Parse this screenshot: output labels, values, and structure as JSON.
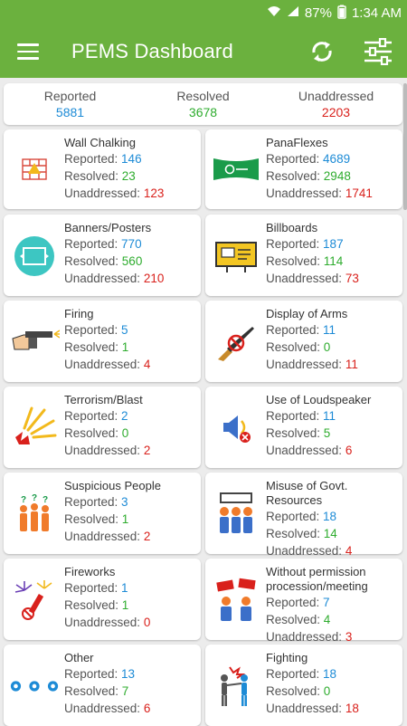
{
  "status_bar": {
    "battery": "87%",
    "time": "1:34 AM"
  },
  "app_bar": {
    "title": "PEMS Dashboard"
  },
  "summary": {
    "reported_label": "Reported",
    "reported_value": "5881",
    "resolved_label": "Resolved",
    "resolved_value": "3678",
    "unaddressed_label": "Unaddressed",
    "unaddressed_value": "2203"
  },
  "labels": {
    "reported": "Reported: ",
    "resolved": "Resolved: ",
    "unaddressed": "Unaddressed: "
  },
  "categories": [
    {
      "title": "Wall Chalking",
      "reported": "146",
      "resolved": "23",
      "unaddressed": "123",
      "icon": "wall-icon"
    },
    {
      "title": "PanaFlexes",
      "reported": "4689",
      "resolved": "2948",
      "unaddressed": "1741",
      "icon": "banner-flag-icon"
    },
    {
      "title": "Banners/Posters",
      "reported": "770",
      "resolved": "560",
      "unaddressed": "210",
      "icon": "poster-icon"
    },
    {
      "title": "Billboards",
      "reported": "187",
      "resolved": "114",
      "unaddressed": "73",
      "icon": "billboard-icon"
    },
    {
      "title": "Firing",
      "reported": "5",
      "resolved": "1",
      "unaddressed": "4",
      "icon": "gun-icon"
    },
    {
      "title": "Display of Arms",
      "reported": "11",
      "resolved": "0",
      "unaddressed": "11",
      "icon": "rifle-icon"
    },
    {
      "title": "Terrorism/Blast",
      "reported": "2",
      "resolved": "0",
      "unaddressed": "2",
      "icon": "blast-icon"
    },
    {
      "title": "Use of Loudspeaker",
      "reported": "11",
      "resolved": "5",
      "unaddressed": "6",
      "icon": "loudspeaker-icon"
    },
    {
      "title": "Suspicious People",
      "reported": "3",
      "resolved": "1",
      "unaddressed": "2",
      "icon": "people-icon"
    },
    {
      "title": "Misuse of Govt. Resources",
      "reported": "18",
      "resolved": "14",
      "unaddressed": "4",
      "icon": "govt-resources-icon"
    },
    {
      "title": "Fireworks",
      "reported": "1",
      "resolved": "1",
      "unaddressed": "0",
      "icon": "fireworks-icon"
    },
    {
      "title": "Without permission procession/meeting",
      "reported": "7",
      "resolved": "4",
      "unaddressed": "3",
      "icon": "procession-icon"
    },
    {
      "title": "Other",
      "reported": "13",
      "resolved": "7",
      "unaddressed": "6",
      "icon": "dots-icon"
    },
    {
      "title": "Fighting",
      "reported": "18",
      "resolved": "0",
      "unaddressed": "18",
      "icon": "fighting-icon"
    }
  ],
  "colors": {
    "primary": "#6bb13e",
    "reported": "#1d8bd6",
    "resolved": "#2eac2e",
    "unaddressed": "#d9211c"
  }
}
